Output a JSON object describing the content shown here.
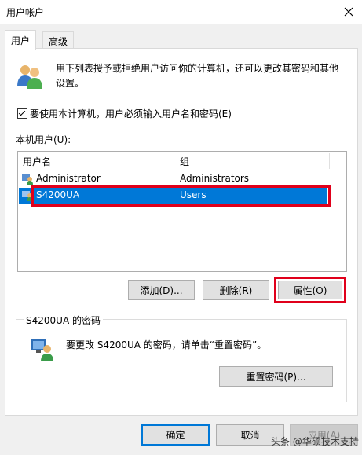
{
  "window": {
    "title": "用户帐户",
    "close_icon": "close-icon"
  },
  "tabs": [
    {
      "label": "用户",
      "active": true
    },
    {
      "label": "高级",
      "active": false
    }
  ],
  "info": {
    "text_line1": "用下列表授予或拒绝用户访问你的计算机，还可以更改其密码和其他",
    "text_line2": "设置。",
    "icon": "users-icon"
  },
  "require_password": {
    "label": "要使用本计算机，用户必须输入用户名和密码(E)",
    "checked": true
  },
  "local_users": {
    "label": "本机用户(U):",
    "columns": [
      "用户名",
      "组"
    ],
    "rows": [
      {
        "name": "Administrator",
        "group": "Administrators",
        "selected": false
      },
      {
        "name": "S4200UA",
        "group": "Users",
        "selected": true
      }
    ]
  },
  "user_buttons": {
    "add": "添加(D)...",
    "remove": "删除(R)",
    "properties": "属性(O)"
  },
  "password_group": {
    "title": "S4200UA 的密码",
    "text": "要更改 S4200UA 的密码，请单击“重置密码”。",
    "reset_button": "重置密码(P)...",
    "icon": "password-user-icon"
  },
  "dialog_buttons": {
    "ok": "确定",
    "cancel": "取消",
    "apply": "应用(A)"
  },
  "watermark": "头条 @华硕技术支持",
  "colors": {
    "selection": "#0078d7",
    "highlight_box": "#e0001b"
  }
}
